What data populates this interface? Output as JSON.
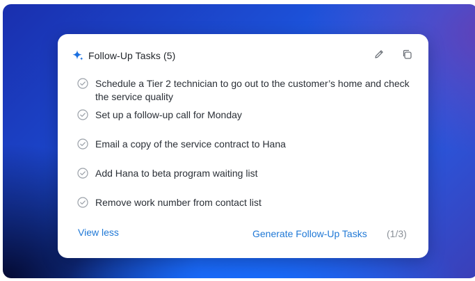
{
  "card": {
    "title": "Follow-Up Tasks",
    "count": "(5)",
    "icons": {
      "sparkle": "sparkle-icon",
      "edit": "pencil-icon",
      "copy": "copy-icon",
      "check": "check-circle-icon"
    },
    "tasks": [
      {
        "text": "Schedule a Tier 2 technician to go out to the customer’s home and check the service quality"
      },
      {
        "text": "Set up a follow-up call for Monday"
      },
      {
        "text": "Email a copy of the service contract to Hana"
      },
      {
        "text": "Add Hana to beta program waiting list"
      },
      {
        "text": "Remove work number from contact list"
      }
    ],
    "footer": {
      "view_less": "View less",
      "generate": "Generate Follow-Up Tasks",
      "pager": "(1/3)"
    }
  },
  "colors": {
    "accent": "#1f78d6",
    "sparkle": "#1a6fe0",
    "text": "#2a2f36",
    "muted": "#8a9098"
  }
}
